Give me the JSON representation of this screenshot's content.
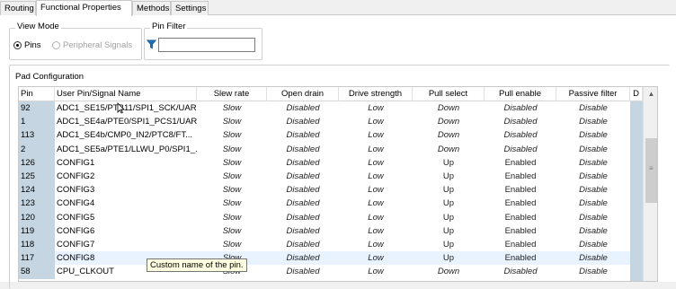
{
  "tabs": [
    {
      "label": "Routing",
      "active": false
    },
    {
      "label": "Functional Properties",
      "active": true
    },
    {
      "label": "Methods",
      "active": false
    },
    {
      "label": "Settings",
      "active": false
    }
  ],
  "view_mode": {
    "title": "View Mode",
    "option_pins": "Pins",
    "option_signals": "Peripheral Signals",
    "selected": "Pins"
  },
  "pin_filter": {
    "title": "Pin Filter",
    "value": ""
  },
  "pad_configuration": {
    "title": "Pad Configuration",
    "columns": [
      "Pin",
      "User Pin/Signal Name",
      "Slew rate",
      "Open drain",
      "Drive strength",
      "Pull select",
      "Pull enable",
      "Passive filter",
      "D"
    ],
    "rows": [
      [
        "92",
        "ADC1_SE15/PTB11/SPI1_SCK/UAR...",
        "Slow",
        "Disabled",
        "Low",
        "Down",
        "Disabled",
        "Disable"
      ],
      [
        "1",
        "ADC1_SE4a/PTE0/SPI1_PCS1/UAR...",
        "Slow",
        "Disabled",
        "Low",
        "Down",
        "Disabled",
        "Disable"
      ],
      [
        "113",
        "ADC1_SE4b/CMP0_IN2/PTC8/FT...",
        "Slow",
        "Disabled",
        "Low",
        "Down",
        "Disabled",
        "Disable"
      ],
      [
        "2",
        "ADC1_SE5a/PTE1/LLWU_P0/SPI1_...",
        "Slow",
        "Disabled",
        "Low",
        "Down",
        "Disabled",
        "Disable"
      ],
      [
        "126",
        "CONFIG1",
        "Slow",
        "Disabled",
        "Low",
        "Up",
        "Enabled",
        "Disable"
      ],
      [
        "125",
        "CONFIG2",
        "Slow",
        "Disabled",
        "Low",
        "Up",
        "Enabled",
        "Disable"
      ],
      [
        "124",
        "CONFIG3",
        "Slow",
        "Disabled",
        "Low",
        "Up",
        "Enabled",
        "Disable"
      ],
      [
        "123",
        "CONFIG4",
        "Slow",
        "Disabled",
        "Low",
        "Up",
        "Enabled",
        "Disable"
      ],
      [
        "120",
        "CONFIG5",
        "Slow",
        "Disabled",
        "Low",
        "Up",
        "Enabled",
        "Disable"
      ],
      [
        "119",
        "CONFIG6",
        "Slow",
        "Disabled",
        "Low",
        "Up",
        "Enabled",
        "Disable"
      ],
      [
        "118",
        "CONFIG7",
        "Slow",
        "Disabled",
        "Low",
        "Up",
        "Enabled",
        "Disable"
      ],
      [
        "117",
        "CONFIG8",
        "Slow",
        "Disabled",
        "Low",
        "Up",
        "Enabled",
        "Disable"
      ],
      [
        "58",
        "CPU_CLKOUT",
        "Slow",
        "Disabled",
        "Low",
        "Down",
        "Disabled",
        "Disable"
      ]
    ],
    "selected_row_pin": "117"
  },
  "tooltip": "Custom name of the pin.",
  "icons": {
    "filter": "funnel-icon",
    "cursor": "mouse-pointer-icon",
    "scroll_up": "chevron-up-icon"
  },
  "colors": {
    "pin_column_bg": "#c5d5e2",
    "selected_row_bg": "#e8f3ff",
    "filter_icon": "#1f6fb5",
    "tooltip_bg": "#ffffe1"
  }
}
